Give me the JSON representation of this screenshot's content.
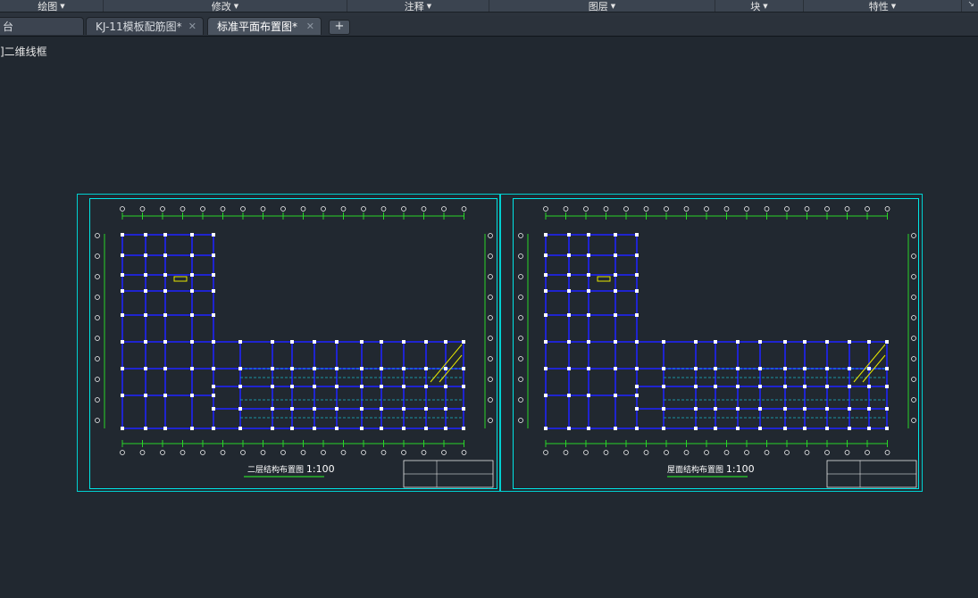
{
  "ribbon": {
    "panels": [
      {
        "label": "绘图"
      },
      {
        "label": "修改"
      },
      {
        "label": "注释"
      },
      {
        "label": "图层"
      },
      {
        "label": "块"
      },
      {
        "label": "特性"
      }
    ]
  },
  "tabs": {
    "items": [
      {
        "label": "台"
      },
      {
        "label": "KJ-11模板配筋图*"
      },
      {
        "label": "标准平面布置图*"
      }
    ],
    "add_label": "+",
    "close_glyph": "✕"
  },
  "viewport": {
    "label": "]二维线框"
  },
  "drawings": {
    "left_title": "二层结构布置图",
    "left_scale": "1:100",
    "right_title": "屋面结构布置图",
    "right_scale": "1:100"
  },
  "colors": {
    "background": "#212830",
    "frame": "#00d0d0",
    "beam": "#1f24d0",
    "column": "#ffffff",
    "dimension": "#29d529",
    "label": "#ffffff",
    "highlight": "#e8e800"
  }
}
